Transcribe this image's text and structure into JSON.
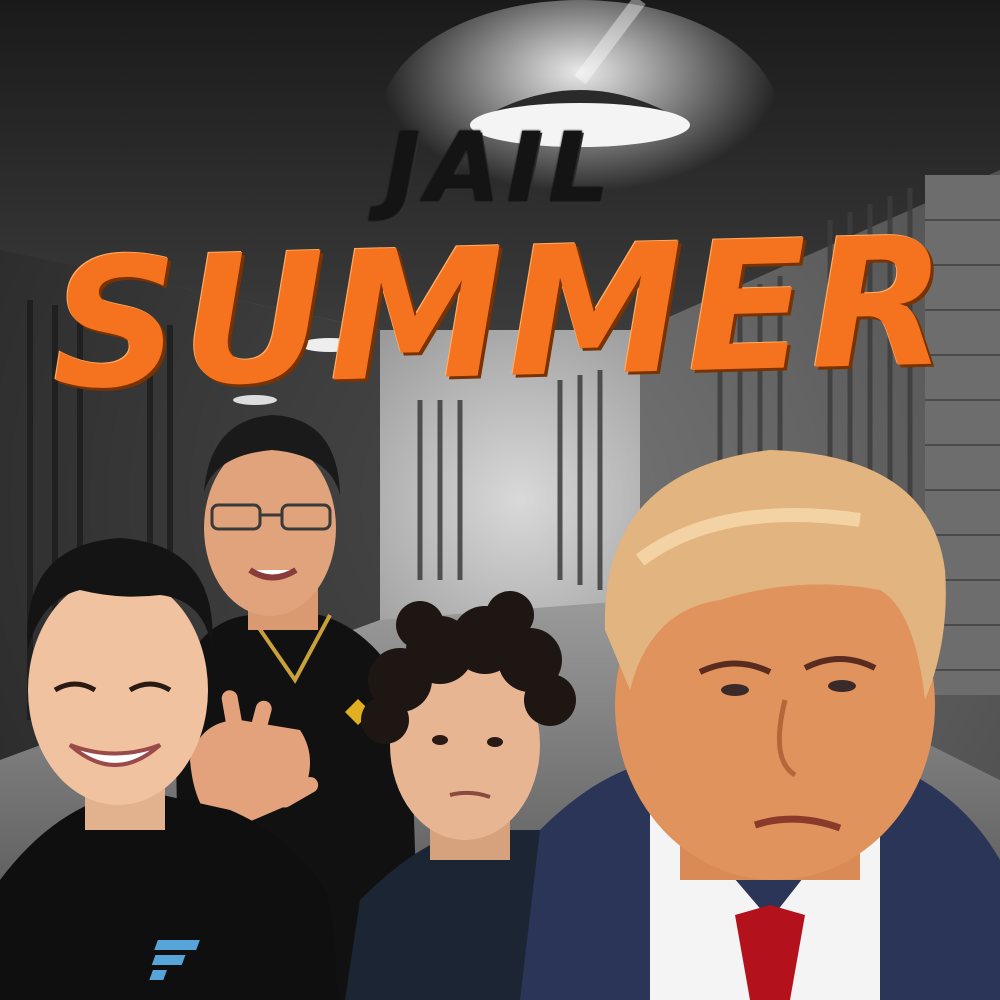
{
  "title": {
    "line1": "JAIL",
    "line2": "SUMMER"
  },
  "colors": {
    "accent": "#f5731f",
    "title_dark": "#141414",
    "suit": "#2b3558",
    "tie": "#b3121c",
    "skin_light": "#e9b692",
    "skin_warm": "#e0935d",
    "hair_blond": "#e2b480"
  },
  "figures": [
    {
      "id": "man-left-black-tshirt",
      "logo": null
    },
    {
      "id": "man-glasses-polo-raising-four-fingers",
      "logo": "diamond-logo-icon"
    },
    {
      "id": "man-curly-hair-navy-tshirt",
      "logo": "ftx-style-logo-icon"
    },
    {
      "id": "man-suit-red-tie-mugshot",
      "logo": null
    }
  ]
}
